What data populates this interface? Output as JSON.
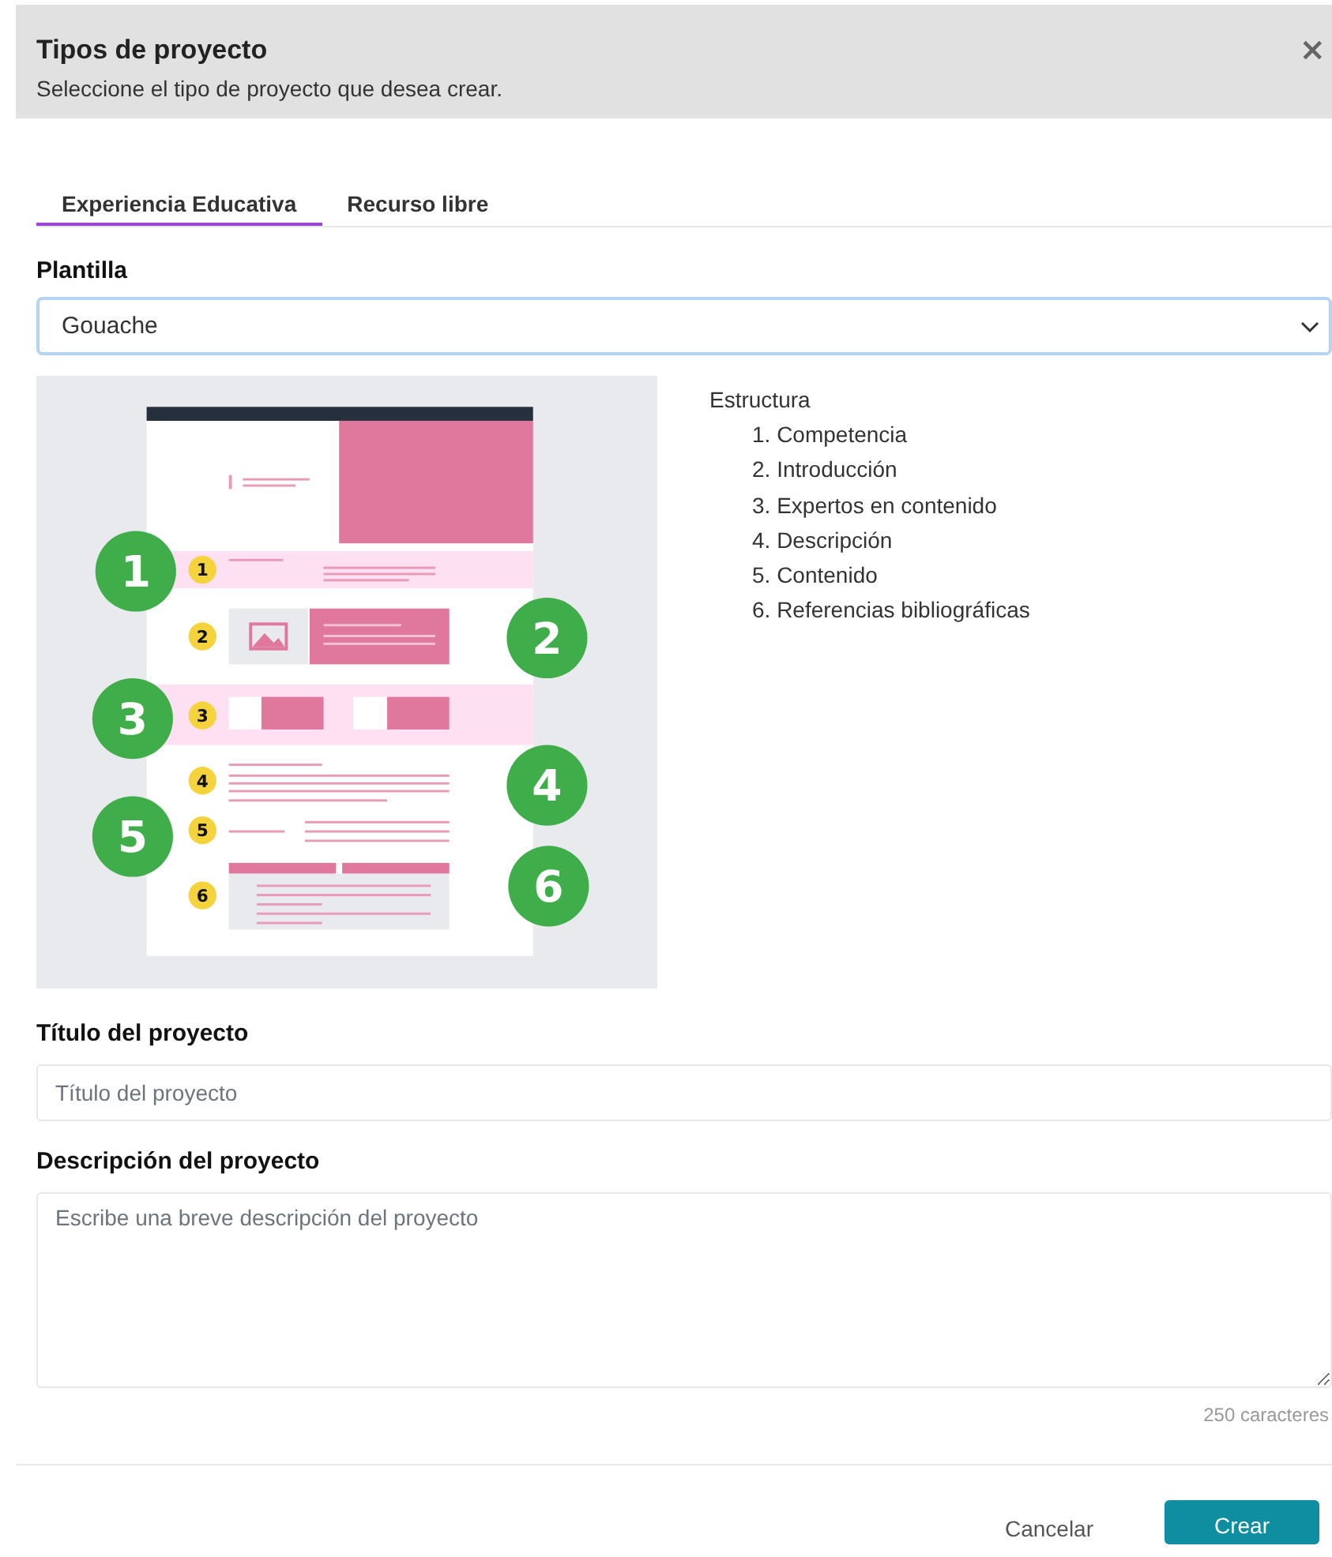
{
  "dialog": {
    "title": "Tipos de proyecto",
    "subtitle": "Seleccione el tipo de proyecto que desea crear.",
    "close": "×"
  },
  "tabs": [
    {
      "label": "Experiencia Educativa",
      "selected": true
    },
    {
      "label": "Recurso libre",
      "selected": false
    }
  ],
  "template": {
    "label": "Plantilla",
    "value": "Gouache"
  },
  "preview": {
    "section_badges": [
      "1",
      "2",
      "3",
      "4",
      "5",
      "6"
    ],
    "callouts": [
      "1",
      "2",
      "3",
      "4",
      "5",
      "6"
    ]
  },
  "structure": {
    "heading": "Estructura",
    "items": [
      "1. Competencia",
      "2. Introducción",
      "3. Expertos en contenido",
      "4. Descripción",
      "5. Contenido",
      "6. Referencias bibliográficas"
    ]
  },
  "title_field": {
    "label": "Título del proyecto",
    "placeholder": "Título del proyecto"
  },
  "description_field": {
    "label": "Descripción del proyecto",
    "placeholder": "Escribe una breve descripción del proyecto",
    "counter": "250 caracteres"
  },
  "buttons": [
    {
      "label": "Cancelar",
      "kind": "secondary"
    },
    {
      "label": "Crear",
      "kind": "primary"
    }
  ]
}
